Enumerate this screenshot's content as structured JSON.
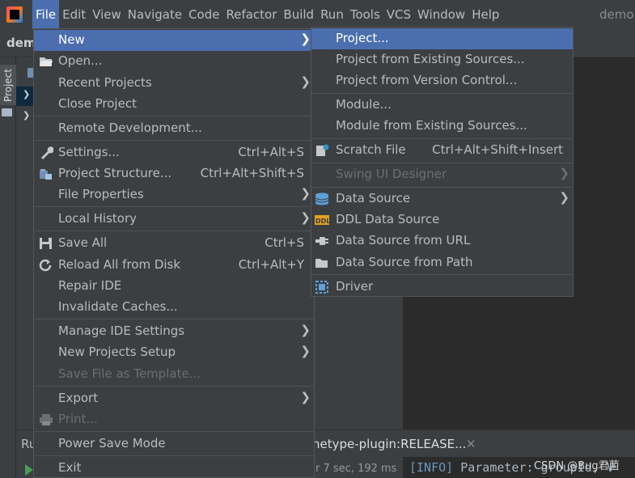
{
  "menubar": {
    "items": [
      "File",
      "Edit",
      "View",
      "Navigate",
      "Code",
      "Refactor",
      "Build",
      "Run",
      "Tools",
      "VCS",
      "Window",
      "Help"
    ],
    "active": "File",
    "title_fragment": "demo"
  },
  "project": {
    "breadcrumb": "dem",
    "side_label": "Project"
  },
  "run": {
    "label": "Ru",
    "tab": "hetype-plugin:RELEASE...",
    "tab_close": "✕",
    "time": "r 7 sec, 192 ms",
    "console_info": "[INFO]",
    "console_text": " Parameter: groupId, V",
    "watermark": "CSDN @Bug君菌"
  },
  "file_menu": {
    "items": [
      {
        "label": "New",
        "shortcut": "",
        "submenu": true,
        "highlighted": true,
        "icon": ""
      },
      {
        "label": "Open...",
        "shortcut": "",
        "submenu": false,
        "icon": "folder-open-icon"
      },
      {
        "label": "Recent Projects",
        "shortcut": "",
        "submenu": true,
        "icon": ""
      },
      {
        "label": "Close Project",
        "shortcut": "",
        "submenu": false,
        "icon": ""
      },
      {
        "label": "Remote Development...",
        "shortcut": "",
        "submenu": false,
        "icon": ""
      },
      {
        "label": "Settings...",
        "shortcut": "Ctrl+Alt+S",
        "submenu": false,
        "icon": "wrench-icon"
      },
      {
        "label": "Project Structure...",
        "shortcut": "Ctrl+Alt+Shift+S",
        "submenu": false,
        "icon": "project-structure-icon"
      },
      {
        "label": "File Properties",
        "shortcut": "",
        "submenu": true,
        "icon": ""
      },
      {
        "label": "Local History",
        "shortcut": "",
        "submenu": true,
        "icon": ""
      },
      {
        "label": "Save All",
        "shortcut": "Ctrl+S",
        "submenu": false,
        "icon": "save-icon"
      },
      {
        "label": "Reload All from Disk",
        "shortcut": "Ctrl+Alt+Y",
        "submenu": false,
        "icon": "reload-icon"
      },
      {
        "label": "Repair IDE",
        "shortcut": "",
        "submenu": false,
        "icon": ""
      },
      {
        "label": "Invalidate Caches...",
        "shortcut": "",
        "submenu": false,
        "icon": ""
      },
      {
        "label": "Manage IDE Settings",
        "shortcut": "",
        "submenu": true,
        "icon": ""
      },
      {
        "label": "New Projects Setup",
        "shortcut": "",
        "submenu": true,
        "icon": ""
      },
      {
        "label": "Save File as Template...",
        "shortcut": "",
        "submenu": false,
        "disabled": true,
        "icon": ""
      },
      {
        "label": "Export",
        "shortcut": "",
        "submenu": true,
        "icon": ""
      },
      {
        "label": "Print...",
        "shortcut": "",
        "submenu": false,
        "disabled": true,
        "icon": "printer-icon"
      },
      {
        "label": "Power Save Mode",
        "shortcut": "",
        "submenu": false,
        "icon": ""
      },
      {
        "label": "Exit",
        "shortcut": "",
        "submenu": false,
        "icon": ""
      }
    ]
  },
  "new_submenu": {
    "items": [
      {
        "label": "Project...",
        "highlighted": true,
        "icon": ""
      },
      {
        "label": "Project from Existing Sources...",
        "icon": ""
      },
      {
        "label": "Project from Version Control...",
        "icon": ""
      },
      {
        "label": "Module...",
        "icon": ""
      },
      {
        "label": "Module from Existing Sources...",
        "icon": ""
      },
      {
        "label": "Scratch File",
        "shortcut": "Ctrl+Alt+Shift+Insert",
        "icon": "scratch-file-icon"
      },
      {
        "label": "Swing UI Designer",
        "disabled": true,
        "submenu": true,
        "icon": ""
      },
      {
        "label": "Data Source",
        "submenu": true,
        "icon": "database-icon"
      },
      {
        "label": "DDL Data Source",
        "icon": "ddl-icon"
      },
      {
        "label": "Data Source from URL",
        "icon": "plug-icon"
      },
      {
        "label": "Data Source from Path",
        "icon": "folder-icon"
      },
      {
        "label": "Driver",
        "icon": "driver-icon"
      }
    ]
  },
  "colors": {
    "highlight": "#4b6eaf",
    "menu_bg": "#3c3f41",
    "editor_bg": "#2b2b2b"
  }
}
